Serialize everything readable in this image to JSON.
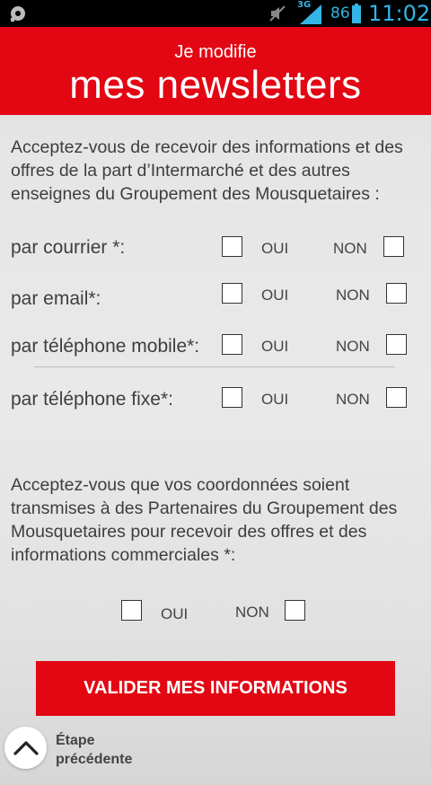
{
  "status_bar": {
    "network": "3G",
    "battery_percent": "86",
    "time": "11:02",
    "icons": [
      "settings-icon",
      "mute-icon",
      "signal-icon",
      "battery-icon"
    ],
    "accent_color": "#33b5e5"
  },
  "header": {
    "subtitle": "Je modifie",
    "title": "mes newsletters",
    "background_color": "#e30613"
  },
  "section1": {
    "question": "Acceptez-vous de recevoir des informations et des offres de la part d’Intermarché et des autres enseignes du Groupement des Mousquetaires :",
    "rows": [
      {
        "label": "par courrier *:",
        "yes": "OUI",
        "no": "NON",
        "yes_checked": false,
        "no_checked": false
      },
      {
        "label": "par email*:",
        "yes": "OUI",
        "no": "NON",
        "yes_checked": false,
        "no_checked": false
      },
      {
        "label": "par téléphone mobile*:",
        "yes": "OUI",
        "no": "NON",
        "yes_checked": false,
        "no_checked": false
      },
      {
        "label": "par téléphone fixe*:",
        "yes": "OUI",
        "no": "NON",
        "yes_checked": false,
        "no_checked": false
      }
    ]
  },
  "section2": {
    "question": "Acceptez-vous que vos coordonnées soient transmises à des  Partenaires du Groupement des Mousquetaires pour recevoir des offres et des informations commerciales *:",
    "yes": "OUI",
    "no": "NON",
    "yes_checked": false,
    "no_checked": false
  },
  "submit_label": "VALIDER MES INFORMATIONS",
  "back": {
    "line1": "Étape",
    "line2": "précédente",
    "icon": "chevron-up-icon"
  }
}
